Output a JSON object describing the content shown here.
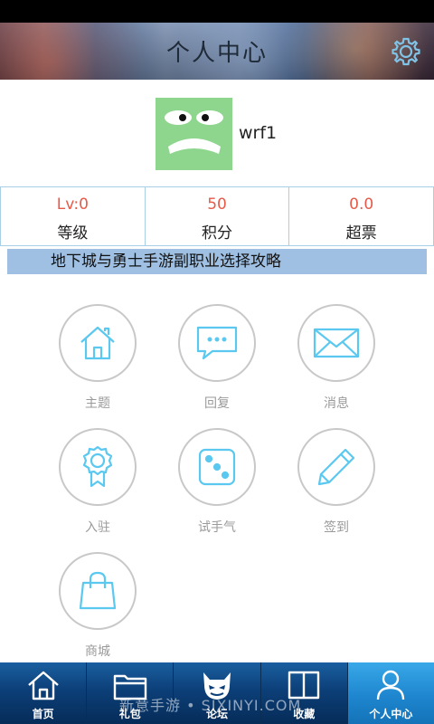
{
  "header": {
    "title": "个人中心",
    "settings_icon": "gear-icon"
  },
  "profile": {
    "username": "wrf1",
    "avatar_icon": "grumpy-face-avatar"
  },
  "stats": [
    {
      "value": "Lv:0",
      "label": "等级"
    },
    {
      "value": "50",
      "label": "积分"
    },
    {
      "value": "0.0",
      "label": "超票"
    }
  ],
  "banner": {
    "text": "地下城与勇士手游副职业选择攻略"
  },
  "grid": [
    {
      "label": "主题",
      "icon": "home-icon"
    },
    {
      "label": "回复",
      "icon": "chat-bubble-icon"
    },
    {
      "label": "消息",
      "icon": "envelope-icon"
    },
    {
      "label": "入驻",
      "icon": "award-ribbon-icon"
    },
    {
      "label": "试手气",
      "icon": "dice-icon"
    },
    {
      "label": "签到",
      "icon": "pencil-icon"
    },
    {
      "label": "商城",
      "icon": "shopping-bag-icon"
    }
  ],
  "tabs": [
    {
      "label": "首页",
      "icon": "home-icon"
    },
    {
      "label": "礼包",
      "icon": "folder-icon"
    },
    {
      "label": "论坛",
      "icon": "devil-face-icon"
    },
    {
      "label": "收藏",
      "icon": "book-icon"
    },
    {
      "label": "个人中心",
      "icon": "person-icon",
      "active": true
    }
  ],
  "watermark": "新意手游 • SIXINYI.COM",
  "colors": {
    "accent": "#5bc8f0",
    "stat_value": "#e65a4a",
    "banner_bg": "#9fc0e2",
    "tab_active": "#1e86cf"
  }
}
